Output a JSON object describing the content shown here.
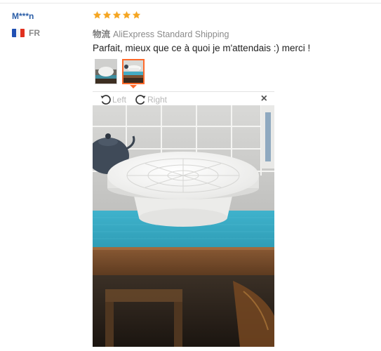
{
  "reviewer": {
    "name": "M***n",
    "country_code": "FR",
    "flag_colors": [
      "#1f4fb2",
      "#ffffff",
      "#e1301f"
    ]
  },
  "rating": {
    "stars": 5,
    "max": 5,
    "color": "#f5a623"
  },
  "shipping": {
    "label": "物流",
    "method": "AliExpress Standard Shipping"
  },
  "review": {
    "text": "Parfait, mieux que ce à quoi je m'attendais :) merci !"
  },
  "thumbnails": [
    {
      "icon": "photo-thumbnail",
      "selected": false
    },
    {
      "icon": "photo-thumbnail",
      "selected": true
    }
  ],
  "viewer": {
    "rotate_left_label": "Left",
    "rotate_right_label": "Right",
    "close_label": "×",
    "accent_color": "#ff6a2b"
  }
}
